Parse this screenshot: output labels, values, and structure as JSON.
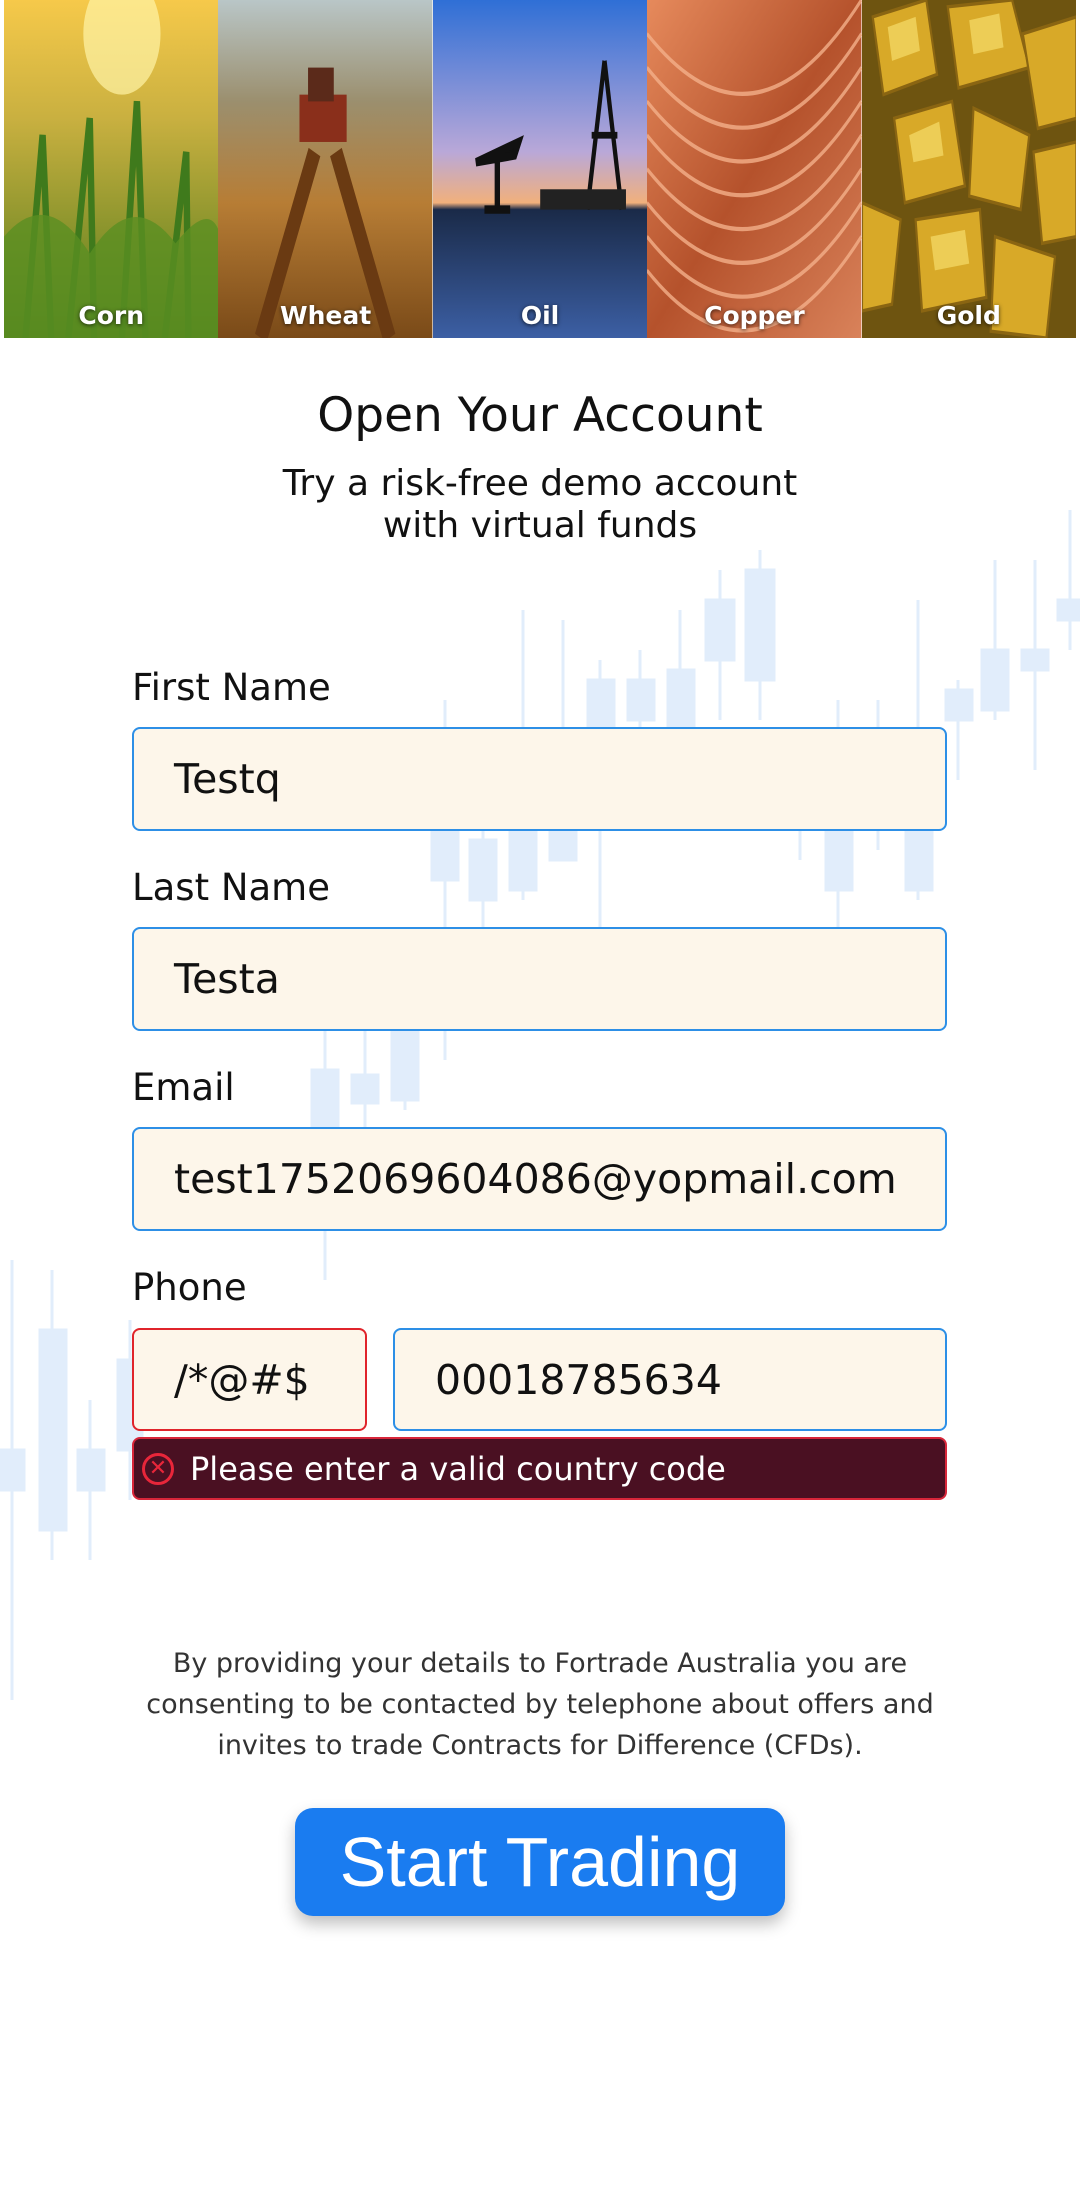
{
  "commodities": [
    {
      "label": "Corn"
    },
    {
      "label": "Wheat"
    },
    {
      "label": "Oil"
    },
    {
      "label": "Copper"
    },
    {
      "label": "Gold"
    }
  ],
  "form": {
    "title": "Open Your Account",
    "subtitle": "Try a risk-free demo account with virtual funds",
    "first_name": {
      "label": "First Name",
      "value": "Testq"
    },
    "last_name": {
      "label": "Last Name",
      "value": "Testa"
    },
    "email": {
      "label": "Email",
      "value": "test1752069604086@yopmail.com"
    },
    "phone": {
      "label": "Phone",
      "country_code": "/*@#$",
      "number": "00018785634",
      "error": "Please enter a valid country code"
    },
    "disclaimer": "By providing your details to Fortrade Australia you are consenting to be contacted by telephone about offers and invites to trade Contracts for Difference (CFDs).",
    "submit_label": "Start Trading"
  },
  "colors": {
    "accent": "#1a7cf0",
    "input_border": "#2d8fe6",
    "input_bg": "#fdf6ea",
    "error": "#e0242b",
    "error_bg": "#4a1022"
  },
  "icons": {
    "error": "error-circle-x-icon"
  }
}
